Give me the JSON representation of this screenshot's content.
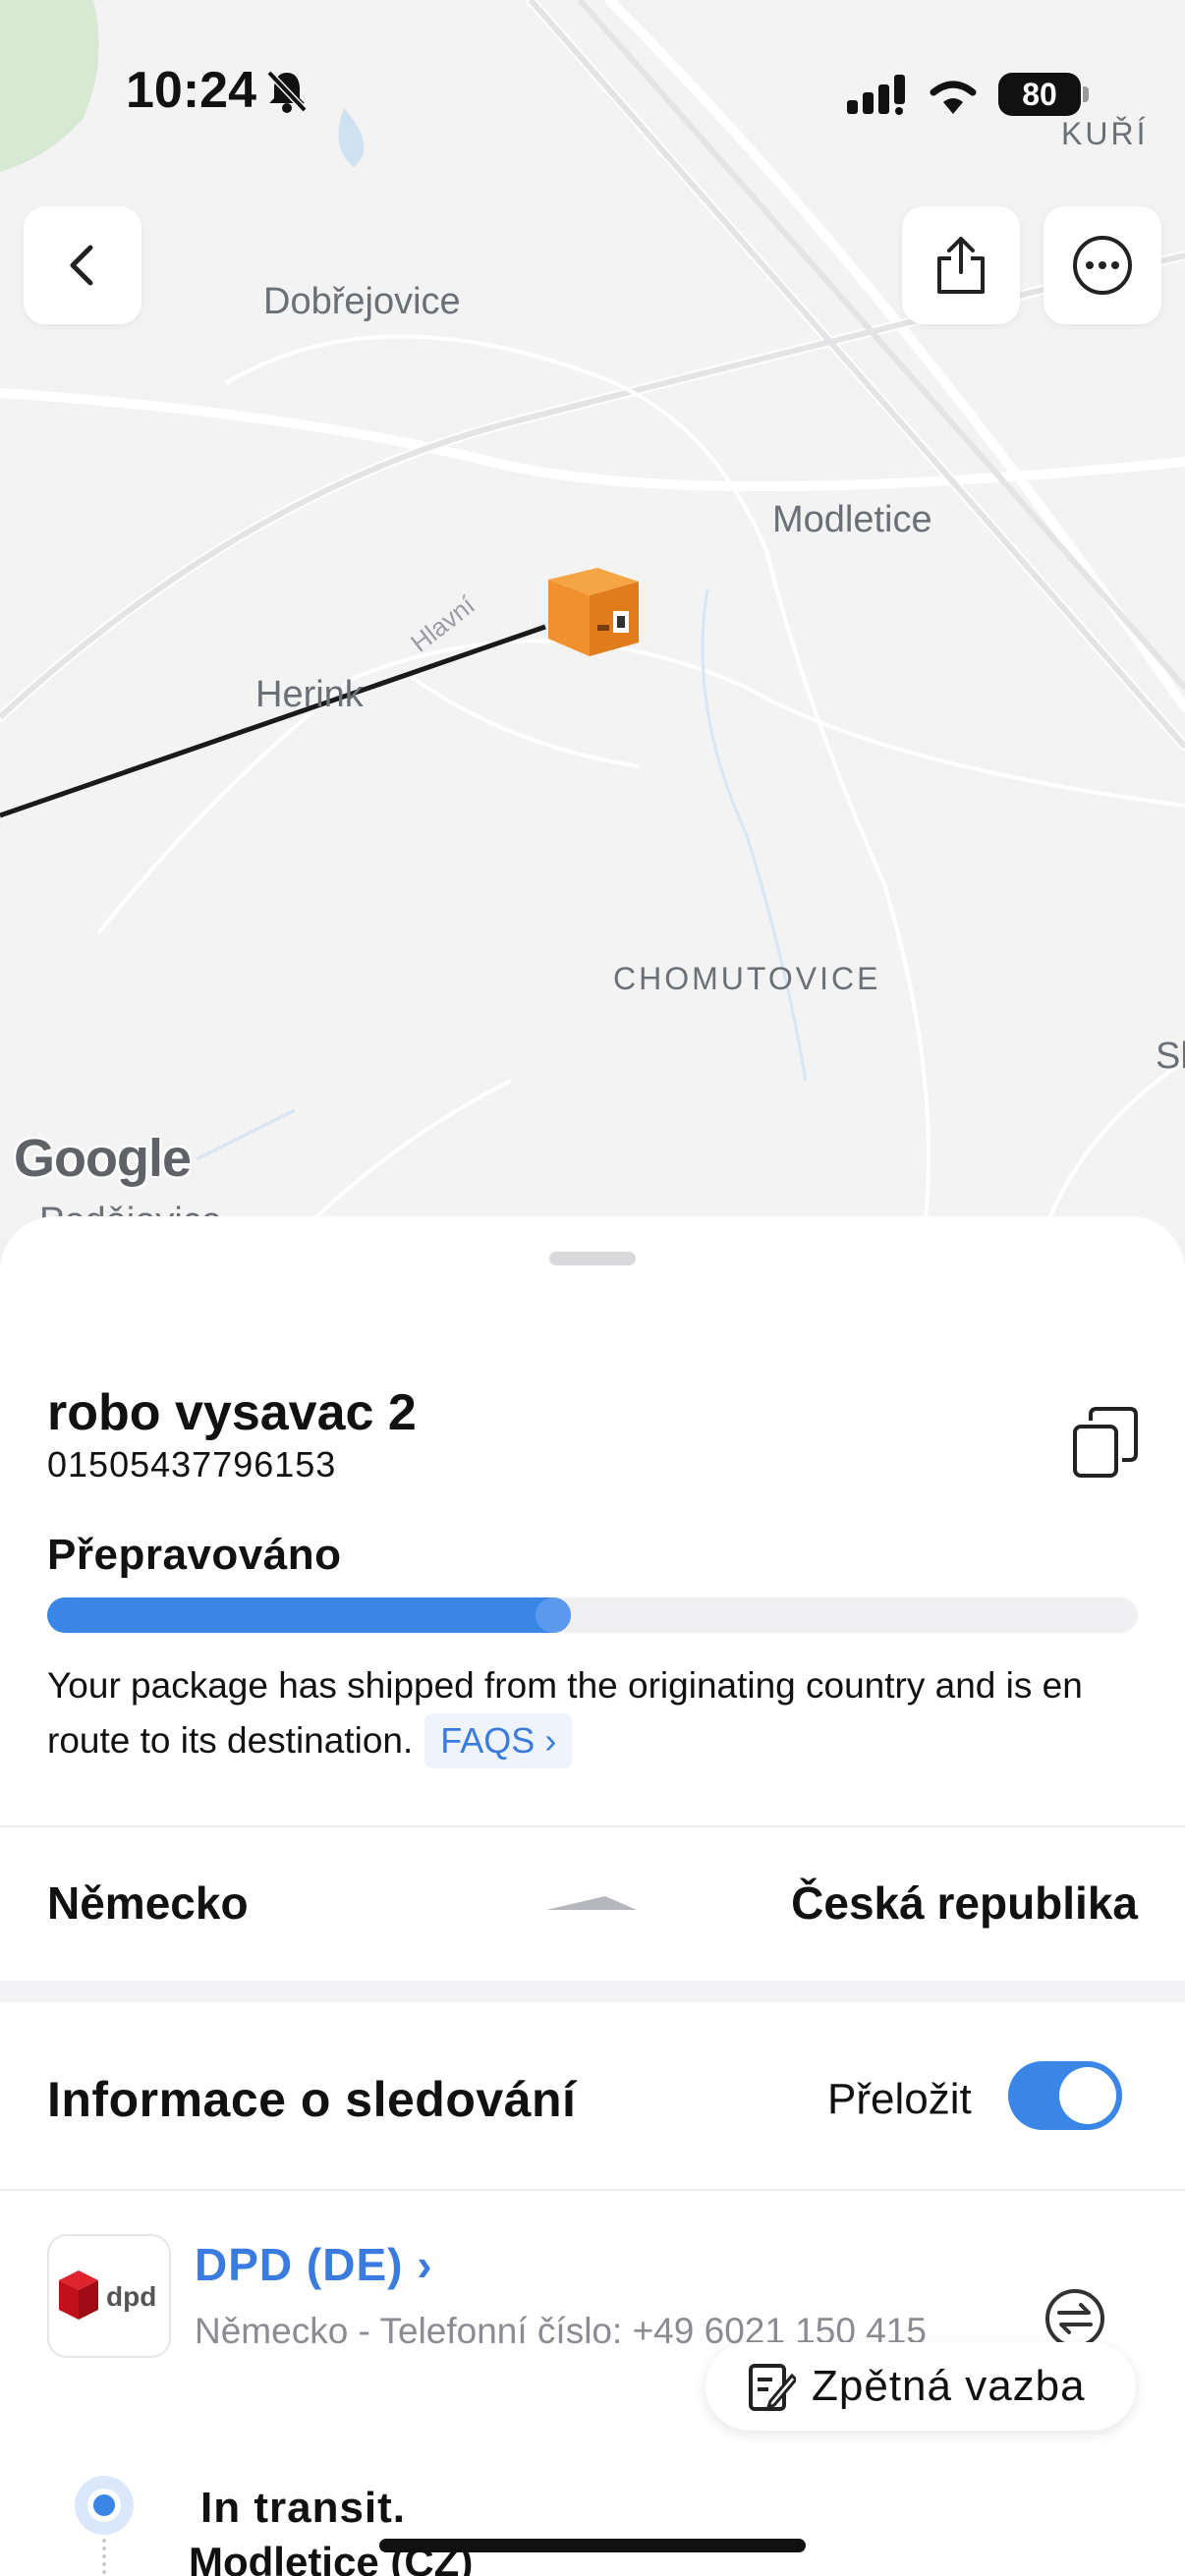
{
  "status_bar": {
    "time": "10:24",
    "battery": "80"
  },
  "map": {
    "places": {
      "dobrejovice": "Dobřejovice",
      "modletice": "Modletice",
      "herink": "Herink",
      "chomutovice": "CHOMUTOVICE",
      "kuri": "KUŘÍ",
      "hlavni": "Hlavní",
      "podsiovice": "Podějovice",
      "edge_s": "Sl"
    },
    "attribution": "Google"
  },
  "package": {
    "name": "robo vysavac 2",
    "tracking_number": "01505437796153",
    "status": "Přepravováno",
    "progress_percent": 48,
    "description": "Your package has shipped from the originating country and is en route to its destination.",
    "faq_label": "FAQS ›"
  },
  "route": {
    "from": "Německo",
    "to": "Česká republika"
  },
  "tracking": {
    "title": "Informace o sledování",
    "translate_label": "Přeložit",
    "translate_on": true,
    "carrier_name": "DPD (DE) ›",
    "carrier_logo_text": "dpd",
    "carrier_info": "Německo - Telefonní číslo: +49 6021 150 415",
    "feedback_label": "Zpětná vazba",
    "events": [
      {
        "title": "In transit.",
        "place": "Modletice (CZ)"
      }
    ]
  },
  "colors": {
    "accent": "#3a86e6",
    "link": "#3a7be0",
    "package_orange": "#f0902e",
    "dpd_red": "#d2101e"
  }
}
